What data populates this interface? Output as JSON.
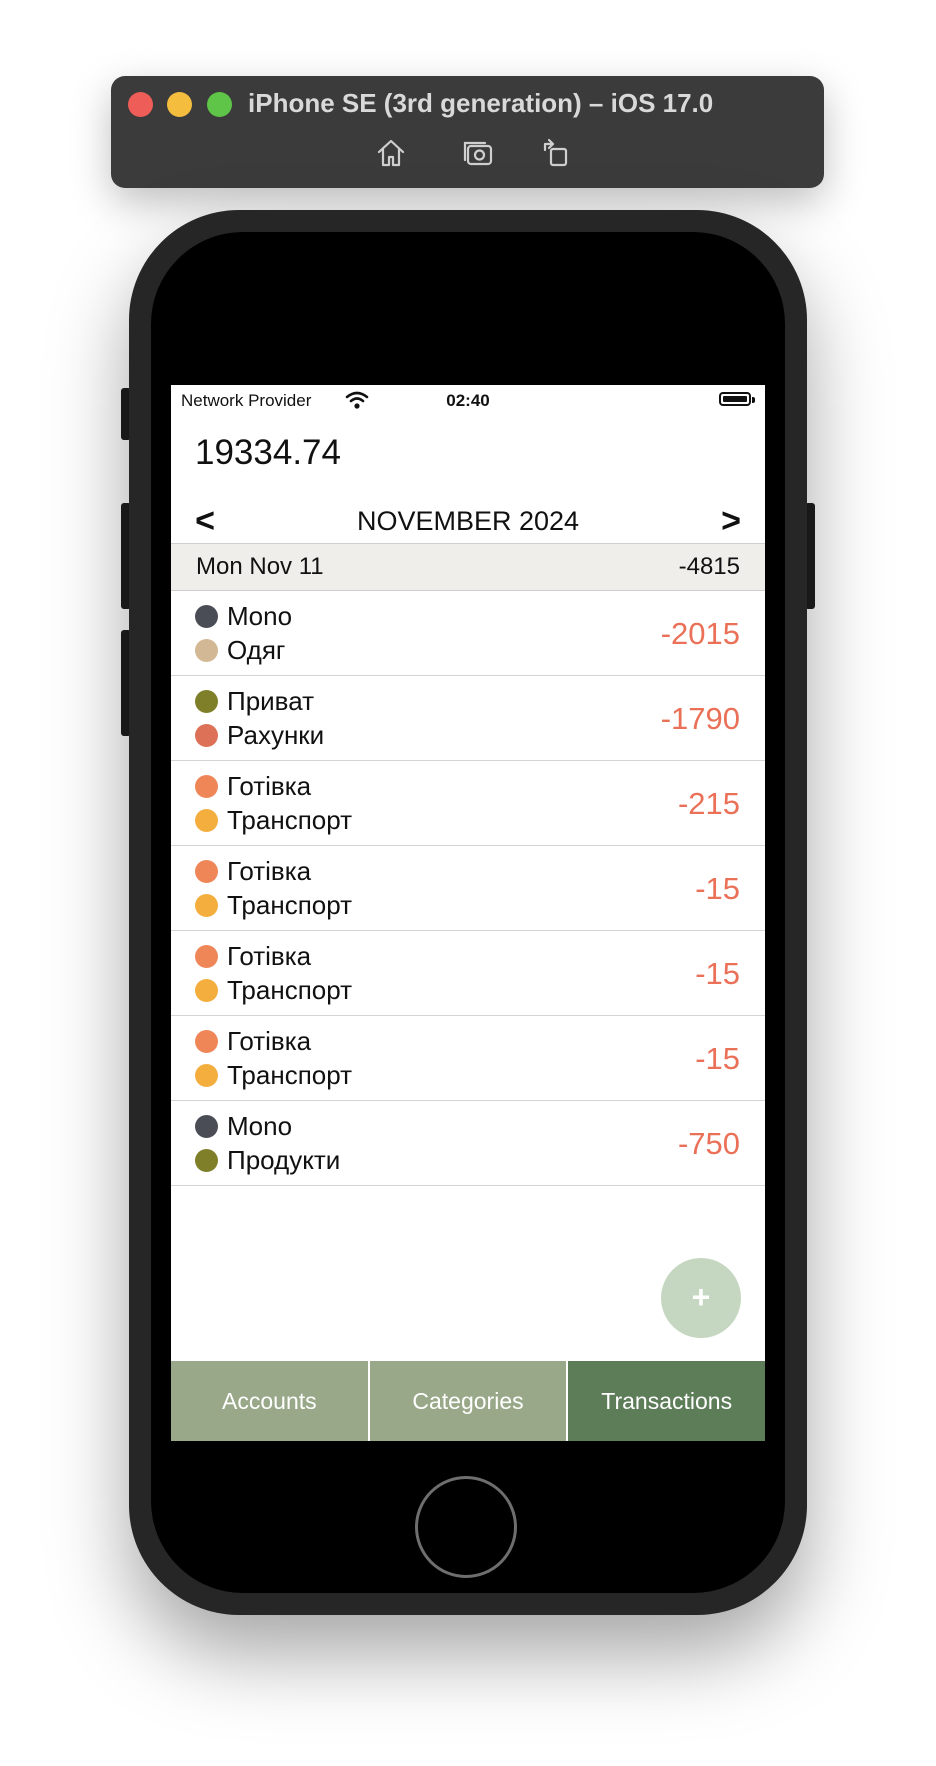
{
  "simulator": {
    "title": "iPhone SE (3rd generation) – iOS 17.0",
    "tools": [
      "home-icon",
      "screenshot-icon",
      "rotate-icon"
    ]
  },
  "status_bar": {
    "carrier": "Network Provider",
    "time": "02:40"
  },
  "balance": "19334.74",
  "month_nav": {
    "prev": "<",
    "label": "NOVEMBER 2024",
    "next": ">"
  },
  "day_group": {
    "date": "Mon Nov 11",
    "total": "-4815"
  },
  "transactions": [
    {
      "account": "Mono",
      "account_color": "#4a4d55",
      "category": "Одяг",
      "category_color": "#d2b895",
      "amount": "-2015"
    },
    {
      "account": "Приват",
      "account_color": "#7f7f2a",
      "category": "Рахунки",
      "category_color": "#dd7157",
      "amount": "-1790"
    },
    {
      "account": "Готівка",
      "account_color": "#ef8658",
      "category": "Транспорт",
      "category_color": "#f4ae3e",
      "amount": "-215"
    },
    {
      "account": "Готівка",
      "account_color": "#ef8658",
      "category": "Транспорт",
      "category_color": "#f4ae3e",
      "amount": "-15"
    },
    {
      "account": "Готівка",
      "account_color": "#ef8658",
      "category": "Транспорт",
      "category_color": "#f4ae3e",
      "amount": "-15"
    },
    {
      "account": "Готівка",
      "account_color": "#ef8658",
      "category": "Транспорт",
      "category_color": "#f4ae3e",
      "amount": "-15"
    },
    {
      "account": "Mono",
      "account_color": "#4a4d55",
      "category": "Продукти",
      "category_color": "#7f7f2a",
      "amount": "-750"
    }
  ],
  "fab_label": "+",
  "tabs": [
    {
      "label": "Accounts",
      "active": false
    },
    {
      "label": "Categories",
      "active": false
    },
    {
      "label": "Transactions",
      "active": true
    }
  ],
  "colors": {
    "amount_negative": "#ea7158",
    "tab_inactive": "#98a888",
    "tab_active": "#5d7c58",
    "fab": "#c5d7c0",
    "day_header_bg": "#f0eeea"
  }
}
